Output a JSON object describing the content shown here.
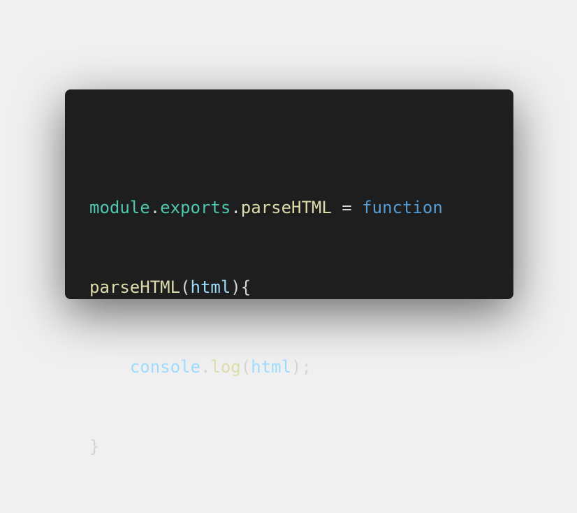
{
  "code_window": {
    "lines": [
      {
        "tokens": [
          {
            "text": "module",
            "kind": "object"
          },
          {
            "text": ".",
            "kind": "punct"
          },
          {
            "text": "exports",
            "kind": "prop"
          },
          {
            "text": ".",
            "kind": "punct"
          },
          {
            "text": "parseHTML",
            "kind": "func"
          },
          {
            "text": " = ",
            "kind": "punct"
          },
          {
            "text": "function",
            "kind": "keyword"
          }
        ]
      },
      {
        "tokens": [
          {
            "text": "parseHTML",
            "kind": "func"
          },
          {
            "text": "(",
            "kind": "punct"
          },
          {
            "text": "html",
            "kind": "param"
          },
          {
            "text": "){",
            "kind": "punct"
          }
        ]
      },
      {
        "tokens": [
          {
            "text": "    ",
            "kind": "punct"
          },
          {
            "text": "console",
            "kind": "param"
          },
          {
            "text": ".",
            "kind": "punct"
          },
          {
            "text": "log",
            "kind": "func"
          },
          {
            "text": "(",
            "kind": "punct"
          },
          {
            "text": "html",
            "kind": "param"
          },
          {
            "text": ");",
            "kind": "punct"
          }
        ]
      },
      {
        "tokens": [
          {
            "text": "}",
            "kind": "punct"
          }
        ]
      }
    ]
  },
  "theme": {
    "page_background": "#f0f0f0",
    "editor_background": "#1e1e1e",
    "object_color": "#4ec9b0",
    "function_color": "#dcdcaa",
    "keyword_color": "#569cd6",
    "parameter_color": "#9cdcfe",
    "punctuation_color": "#d4d4d4"
  }
}
